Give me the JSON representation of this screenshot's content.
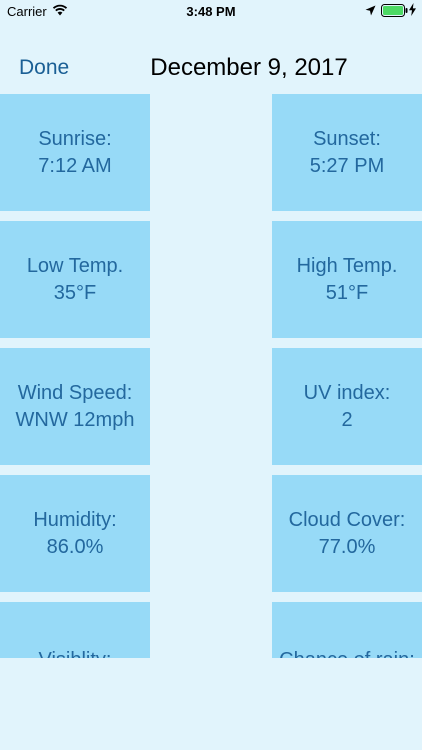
{
  "status_bar": {
    "carrier": "Carrier",
    "time": "3:48 PM"
  },
  "nav": {
    "done_label": "Done",
    "title": "December 9, 2017"
  },
  "tiles": [
    {
      "label": "Sunrise:",
      "value": "7:12 AM"
    },
    {
      "label": "Sunset:",
      "value": "5:27 PM"
    },
    {
      "label": "Low Temp.",
      "value": "35°F"
    },
    {
      "label": "High Temp.",
      "value": "51°F"
    },
    {
      "label": "Wind Speed:",
      "value": "WNW 12mph"
    },
    {
      "label": "UV index:",
      "value": "2"
    },
    {
      "label": "Humidity:",
      "value": "86.0%"
    },
    {
      "label": "Cloud Cover:",
      "value": "77.0%"
    },
    {
      "label": "Visiblity:",
      "value": ""
    },
    {
      "label": "Chance of rain:",
      "value": ""
    }
  ]
}
